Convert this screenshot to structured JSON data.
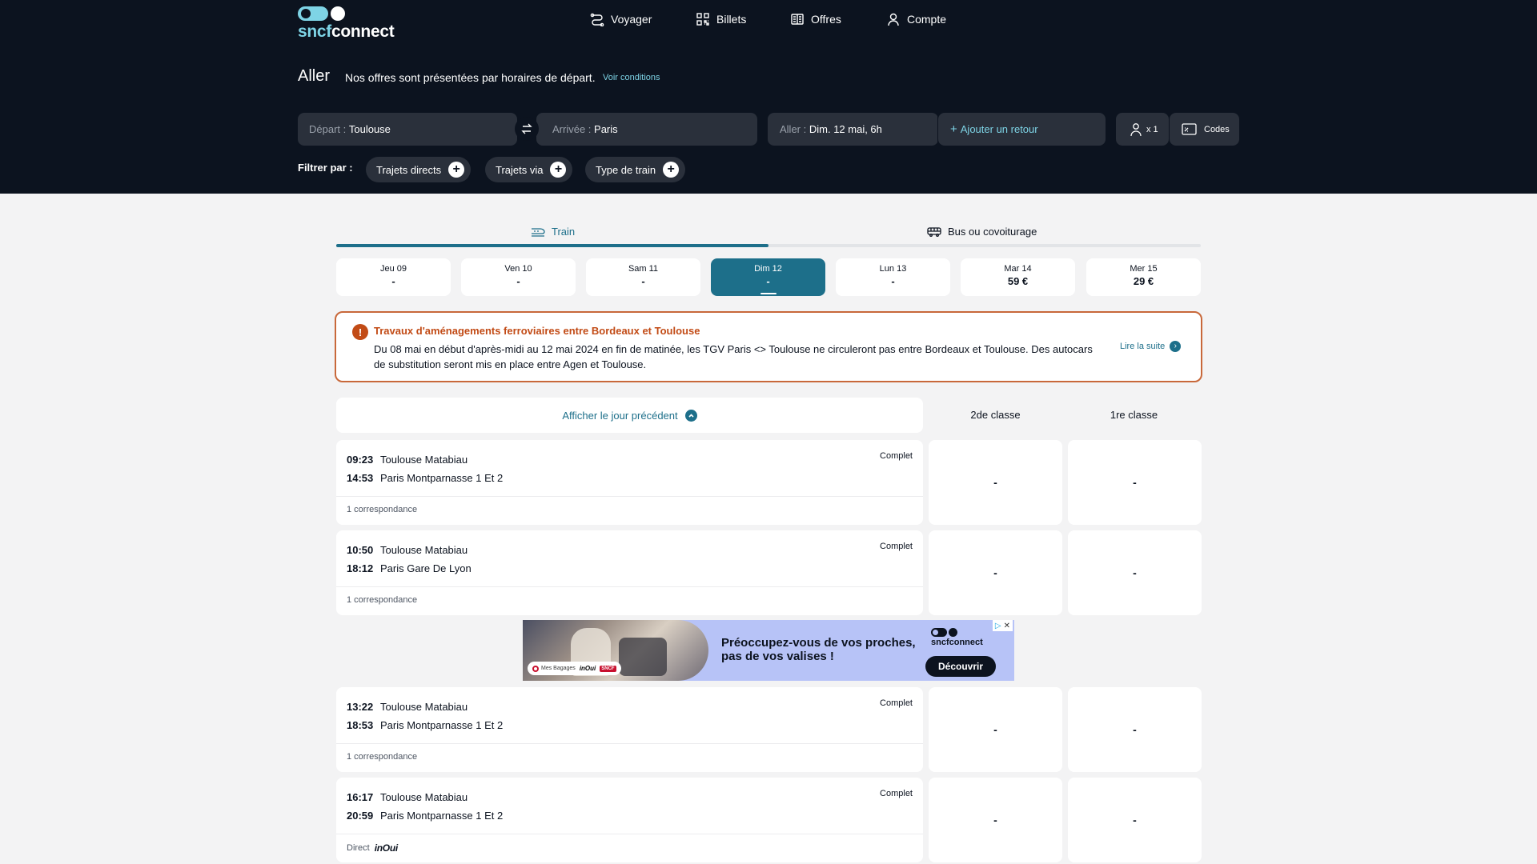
{
  "brand": {
    "name_part1": "sncf",
    "name_part2": "connect"
  },
  "nav": {
    "items": [
      {
        "label": "Voyager",
        "icon": "route-icon"
      },
      {
        "label": "Billets",
        "icon": "qr-code-icon"
      },
      {
        "label": "Offres",
        "icon": "offers-icon"
      },
      {
        "label": "Compte",
        "icon": "user-icon"
      }
    ]
  },
  "journey": {
    "title": "Aller",
    "subtitle": "Nos offres sont présentées par horaires de départ.",
    "conditions_link": "Voir conditions"
  },
  "search": {
    "depart_label": "Départ :",
    "depart_value": "Toulouse",
    "arrivee_label": "Arrivée :",
    "arrivee_value": "Paris",
    "aller_label": "Aller :",
    "aller_value": "Dim. 12 mai, 6h",
    "retour_label": "Ajouter un retour",
    "passengers": "x 1",
    "codes": "Codes"
  },
  "filters": {
    "label": "Filtrer par :",
    "chips": [
      "Trajets directs",
      "Trajets via",
      "Type de train"
    ]
  },
  "tabs": [
    {
      "label": "Train",
      "active": true
    },
    {
      "label": "Bus ou covoiturage",
      "active": false
    }
  ],
  "dates": [
    {
      "day": "Jeu 09",
      "price": "-"
    },
    {
      "day": "Ven 10",
      "price": "-"
    },
    {
      "day": "Sam 11",
      "price": "-"
    },
    {
      "day": "Dim 12",
      "price": "-",
      "selected": true
    },
    {
      "day": "Lun 13",
      "price": "-"
    },
    {
      "day": "Mar 14",
      "price": "59 €"
    },
    {
      "day": "Mer 15",
      "price": "29 €"
    }
  ],
  "alert": {
    "title": "Travaux d'aménagements ferroviaires entre Bordeaux et Toulouse",
    "text": "Du 08 mai en début d'après-midi au 12 mai 2024 en fin de matinée, les TGV Paris <> Toulouse ne circuleront pas entre Bordeaux et Toulouse. Des autocars de substitution seront mis en place entre Agen et Toulouse.",
    "link": "Lire la suite",
    "color": "#c24b16"
  },
  "results": {
    "prev_day": "Afficher le jour précédent",
    "class2": "2de classe",
    "class1": "1re classe",
    "trips": [
      {
        "dep_time": "09:23",
        "dep_station": "Toulouse Matabiau",
        "arr_time": "14:53",
        "arr_station": "Paris Montparnasse 1 Et 2",
        "status": "Complet",
        "connection": "1 correspondance",
        "price2": "-",
        "price1": "-"
      },
      {
        "dep_time": "10:50",
        "dep_station": "Toulouse Matabiau",
        "arr_time": "18:12",
        "arr_station": "Paris Gare De Lyon",
        "status": "Complet",
        "connection": "1 correspondance",
        "price2": "-",
        "price1": "-"
      },
      {
        "dep_time": "13:22",
        "dep_station": "Toulouse Matabiau",
        "arr_time": "18:53",
        "arr_station": "Paris Montparnasse 1 Et 2",
        "status": "Complet",
        "connection": "1 correspondance",
        "price2": "-",
        "price1": "-"
      },
      {
        "dep_time": "16:17",
        "dep_station": "Toulouse Matabiau",
        "arr_time": "20:59",
        "arr_station": "Paris Montparnasse 1 Et 2",
        "status": "Complet",
        "connection": "Direct",
        "train_brand": "inOui",
        "price2": "-",
        "price1": "-"
      }
    ]
  },
  "ad": {
    "headline": "Préoccupez-vous de vos proches, pas de vos valises !",
    "badge_text": "Mes Bagages",
    "badge_brand": "inOui",
    "badge_sncf": "SNCF",
    "logo_text": "sncfconnect",
    "cta": "Découvrir",
    "adchoices": "▷",
    "close": "✕"
  },
  "colors": {
    "header_bg": "#0c131f",
    "accent": "#1d6f8a",
    "accent_light": "#7ed4e6",
    "alert": "#c24b16"
  }
}
